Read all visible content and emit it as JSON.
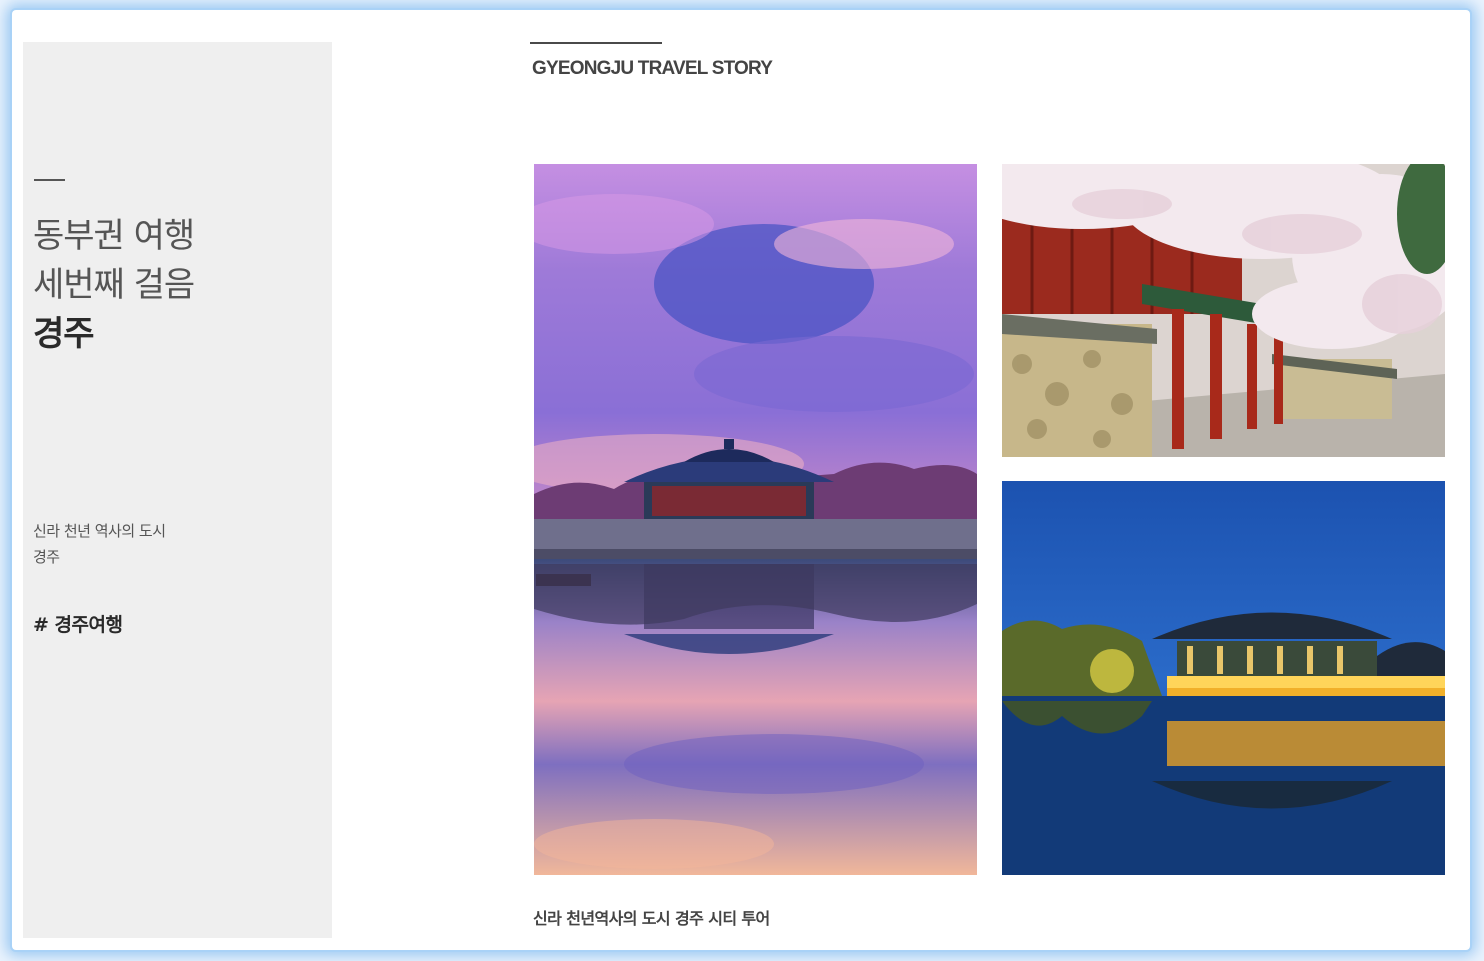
{
  "sidebar": {
    "title_line1": "동부권 여행",
    "title_line2": "세번째 걸음",
    "title_line3": "경주",
    "desc_line1": "신라 천년 역사의 도시",
    "desc_line2": "경주",
    "hashtag": "# 경주여행"
  },
  "main": {
    "heading": "GYEONGJU TRAVEL STORY",
    "caption": "신라 천년역사의 도시 경주 시티 투어"
  },
  "colors": {
    "sidebar_bg": "#efefef",
    "frame_glow": "#9cc9f2"
  }
}
